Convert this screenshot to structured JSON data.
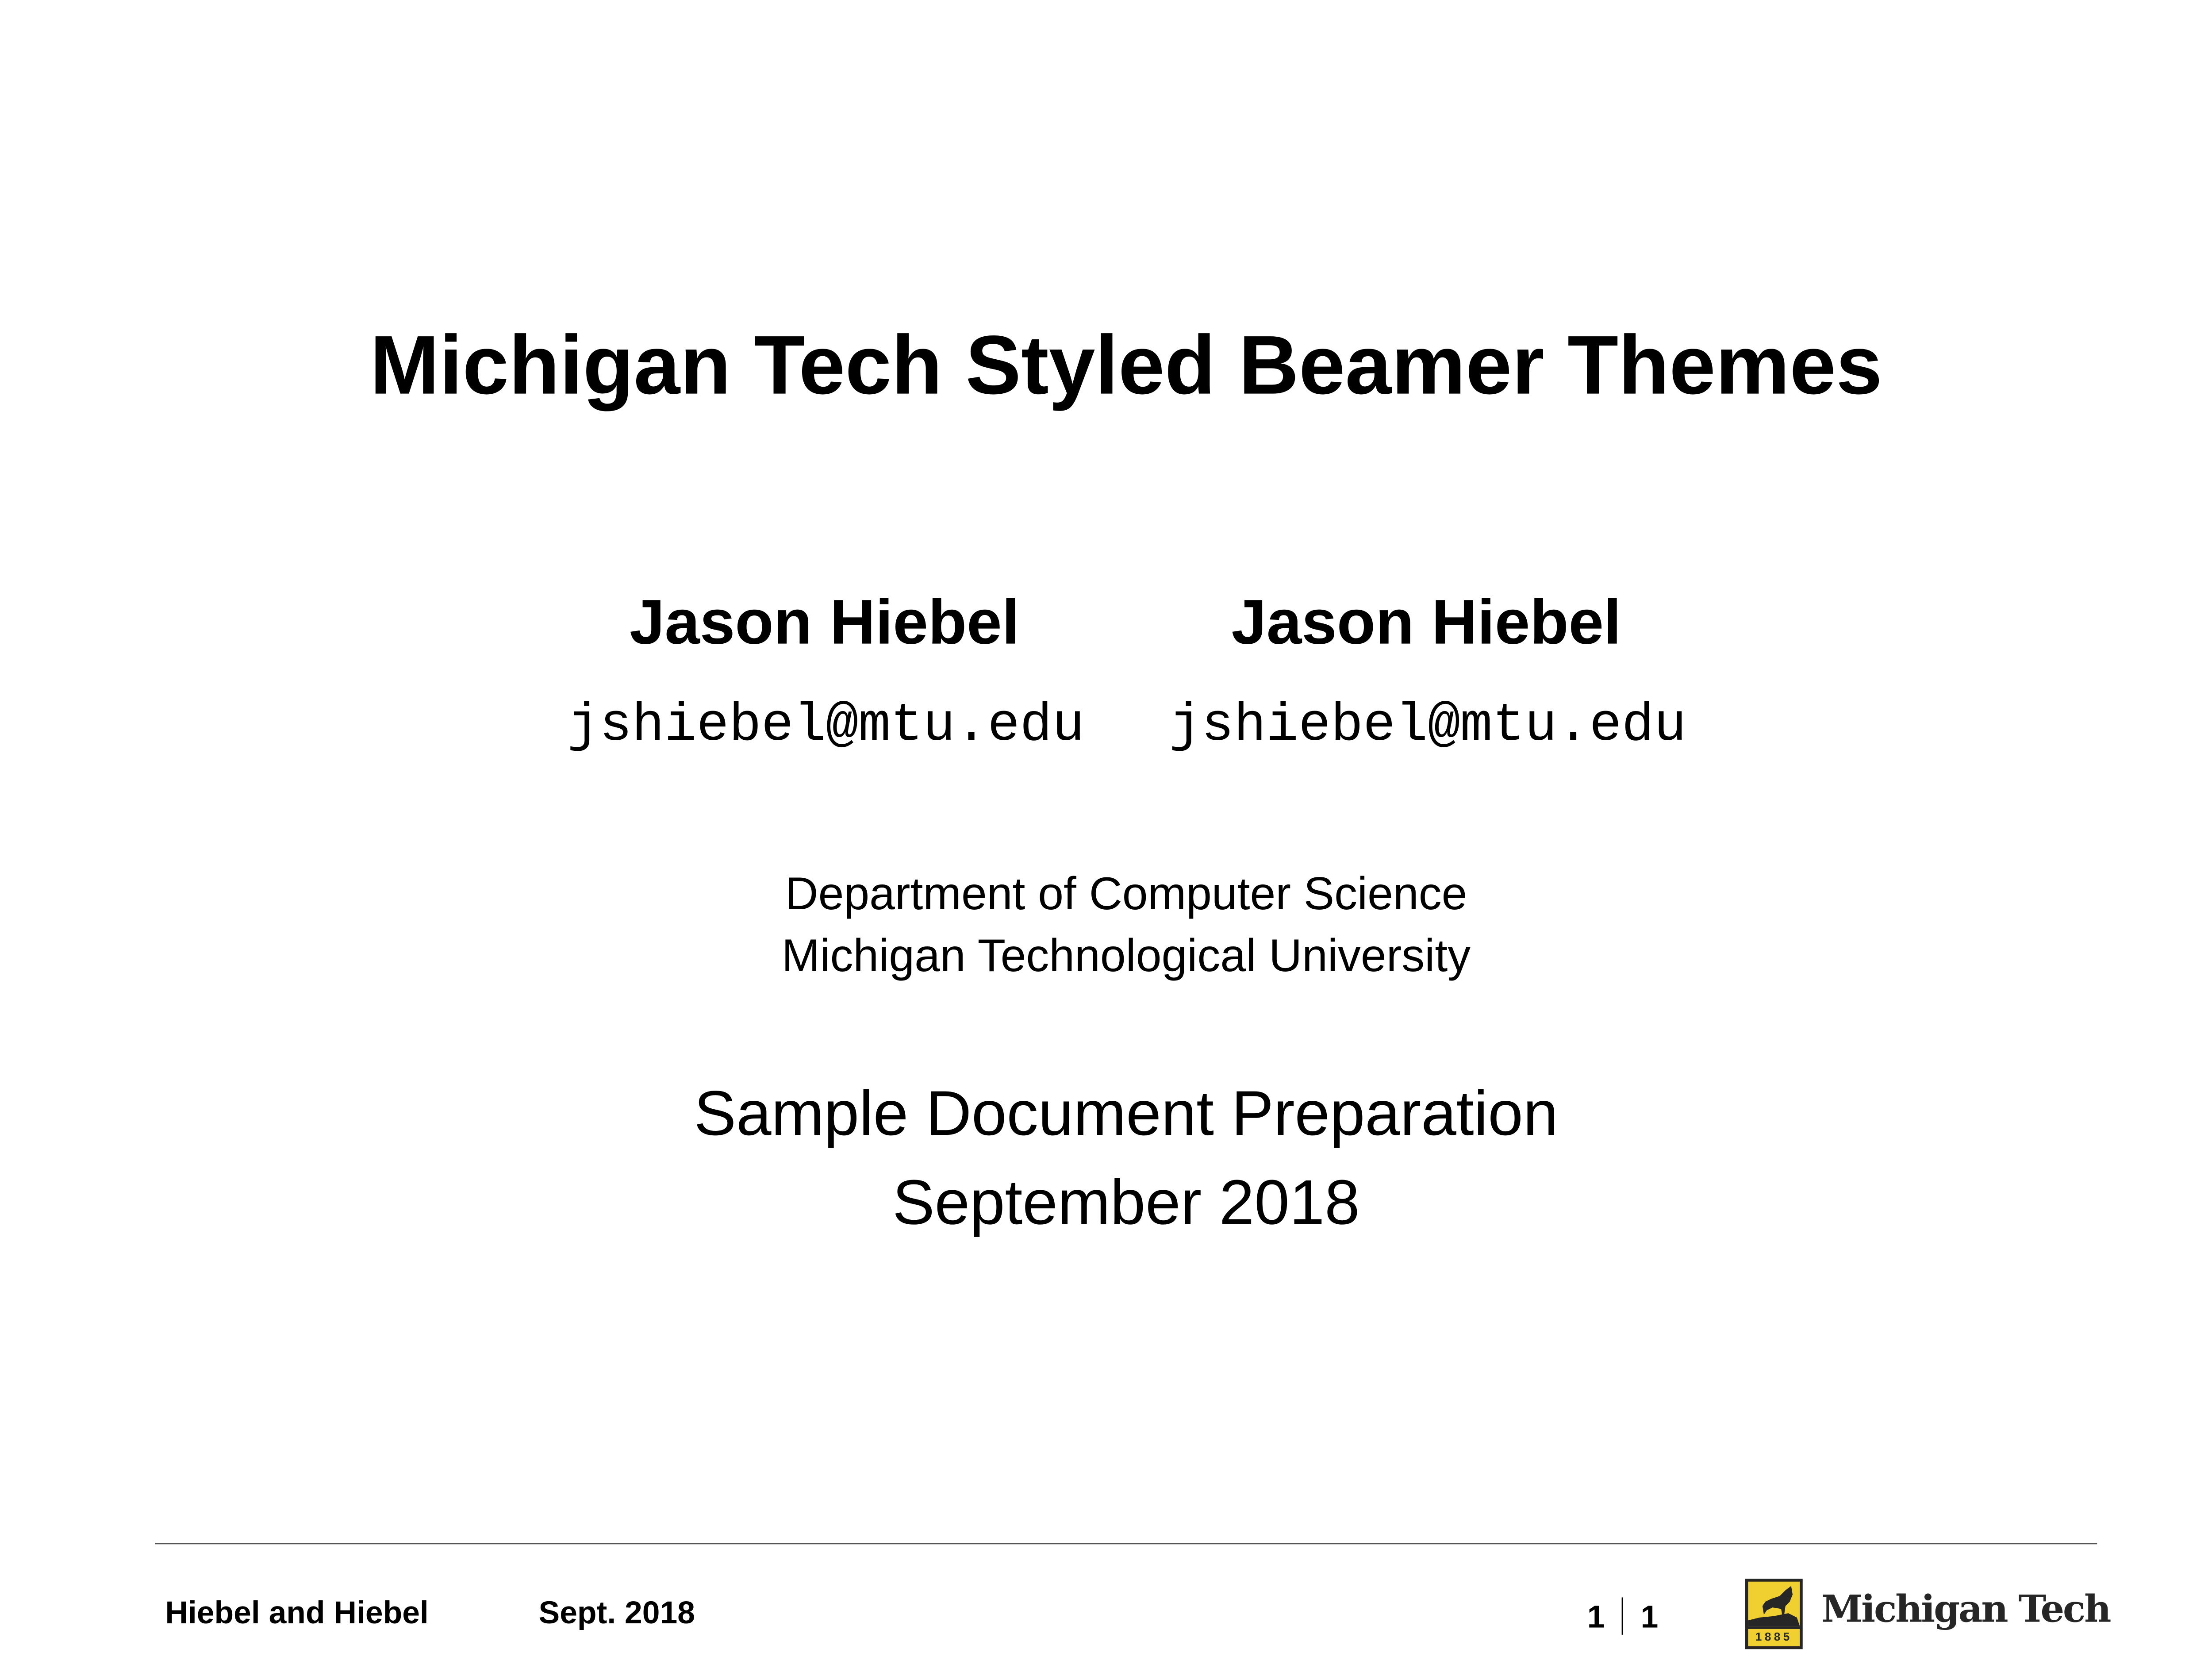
{
  "title": "Michigan Tech Styled Beamer Themes",
  "authors": [
    {
      "name": "Jason Hiebel",
      "email": "jshiebel@mtu.edu"
    },
    {
      "name": "Jason Hiebel",
      "email": "jshiebel@mtu.edu"
    }
  ],
  "institute": [
    "Department of Computer Science",
    "Michigan Technological University"
  ],
  "event": "Sample Document Preparation",
  "date": "September 2018",
  "footer": {
    "short_authors": "Hiebel and Hiebel",
    "short_date": "Sept. 2018",
    "page_current": "1",
    "page_total": "1",
    "logo_year": "1885",
    "logo_text": "Michigan Tech"
  },
  "colors": {
    "logo_gold": "#f0cf30",
    "logo_dark": "#262626",
    "rule": "#555555"
  }
}
